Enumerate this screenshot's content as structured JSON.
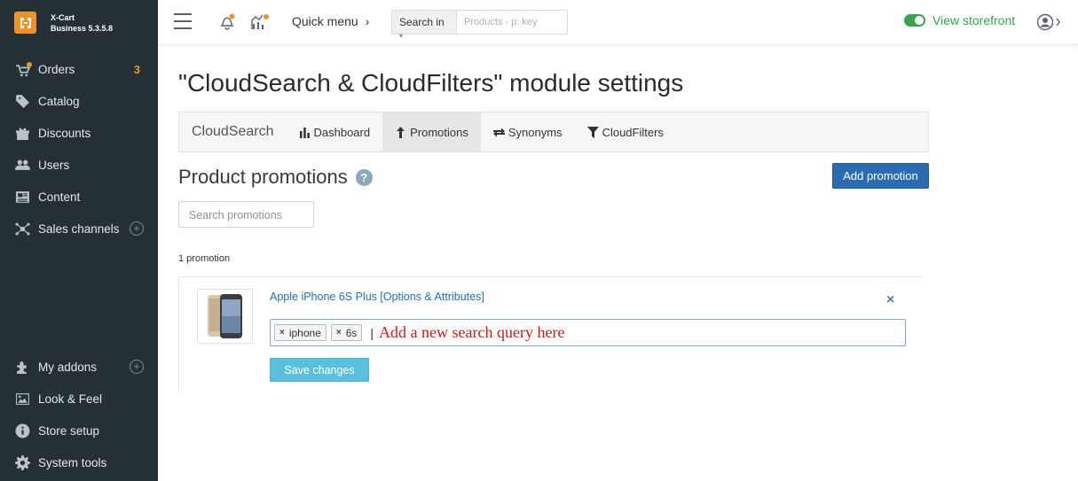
{
  "brand": {
    "name": "X-Cart",
    "edition": "Business 5.3.5.8",
    "logo_icon": "xcart-logo-icon"
  },
  "sidebar": {
    "items": [
      {
        "label": "Orders",
        "icon": "orders-icon",
        "badge": "3"
      },
      {
        "label": "Catalog",
        "icon": "tag-icon"
      },
      {
        "label": "Discounts",
        "icon": "gift-icon"
      },
      {
        "label": "Users",
        "icon": "users-icon"
      },
      {
        "label": "Content",
        "icon": "newspaper-icon"
      },
      {
        "label": "Sales channels",
        "icon": "network-icon",
        "plus": "+"
      }
    ],
    "bottom_items": [
      {
        "label": "My addons",
        "icon": "puzzle-icon",
        "plus": "+"
      },
      {
        "label": "Look & Feel",
        "icon": "image-icon"
      },
      {
        "label": "Store setup",
        "icon": "info-icon"
      },
      {
        "label": "System tools",
        "icon": "gear-icon"
      }
    ]
  },
  "topbar": {
    "quick_menu": "Quick menu",
    "search_in": "Search in",
    "search_placeholder": "Products - p: key",
    "view_storefront": "View storefront"
  },
  "page": {
    "title": "\"CloudSearch & CloudFilters\" module settings",
    "tabs": {
      "brand": "CloudSearch",
      "items": [
        {
          "label": "Dashboard",
          "icon": "bar-chart-icon"
        },
        {
          "label": "Promotions",
          "icon": "arrow-up-icon",
          "active": true
        },
        {
          "label": "Synonyms",
          "icon": "exchange-icon"
        },
        {
          "label": "CloudFilters",
          "icon": "filter-icon"
        }
      ]
    },
    "section_title": "Product promotions",
    "help_icon": "?",
    "add_button": "Add promotion",
    "search_placeholder": "Search promotions",
    "count_text": "1 promotion",
    "promotion": {
      "product": "Apple iPhone 6S Plus [Options & Attributes]",
      "remove": "×",
      "tags": [
        "iphone",
        "6s"
      ],
      "tag_remove": "×",
      "caret": "|",
      "hint": "Add a new search query here",
      "save_button": "Save changes"
    }
  },
  "colors": {
    "sidebar_bg": "#243036",
    "accent_orange": "#f0912a",
    "link_blue": "#2b6cb0",
    "save_blue": "#5bc0de",
    "storefront_green": "#36a54e"
  }
}
